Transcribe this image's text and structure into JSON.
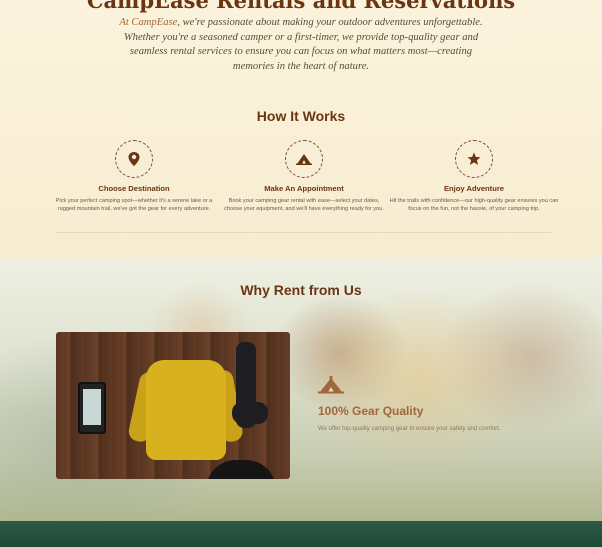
{
  "hero": {
    "title": "CampEase Rentals and Reservations",
    "brand": "At CampEase",
    "text": ", we're passionate about making your outdoor adventures unforgettable. Whether you're a seasoned camper or a first-timer, we provide top-quality gear and seamless rental services to ensure you can focus on what matters most—creating memories in the heart of nature."
  },
  "how": {
    "title": "How It Works",
    "steps": [
      {
        "icon": "location-pin-icon",
        "title": "Choose Destination",
        "desc": "Pick your perfect camping spot—whether it's a serene lake or a rugged mountain trail, we've got the gear for every adventure."
      },
      {
        "icon": "tent-icon",
        "title": "Make An Appointment",
        "desc": "Book your camping gear rental with ease—select your dates, choose your equipment, and we'll have everything ready for you."
      },
      {
        "icon": "star-icon",
        "title": "Enjoy Adventure",
        "desc": "Hit the trails with confidence—our high-quality gear ensures you can focus on the fun, not the hassle, of your camping trip."
      }
    ]
  },
  "why": {
    "title": "Why Rent from Us",
    "feature": {
      "icon": "tent-icon",
      "title": "100% Gear Quality",
      "desc": "We offer top-quality camping gear to ensure your safety and comfort."
    }
  },
  "colors": {
    "heading": "#6b3512",
    "accent": "#a0673a",
    "footer": "#1f4a38",
    "background": "#f7edd2"
  }
}
